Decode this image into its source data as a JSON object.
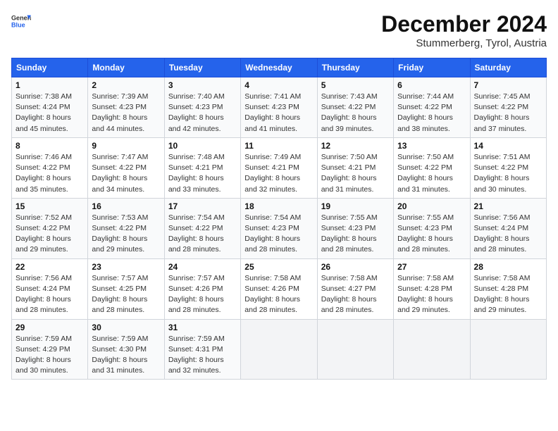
{
  "header": {
    "logo_general": "General",
    "logo_blue": "Blue",
    "month_title": "December 2024",
    "location": "Stummerberg, Tyrol, Austria"
  },
  "weekdays": [
    "Sunday",
    "Monday",
    "Tuesday",
    "Wednesday",
    "Thursday",
    "Friday",
    "Saturday"
  ],
  "weeks": [
    [
      {
        "day": "1",
        "sunrise": "7:38 AM",
        "sunset": "4:24 PM",
        "daylight": "8 hours and 45 minutes."
      },
      {
        "day": "2",
        "sunrise": "7:39 AM",
        "sunset": "4:23 PM",
        "daylight": "8 hours and 44 minutes."
      },
      {
        "day": "3",
        "sunrise": "7:40 AM",
        "sunset": "4:23 PM",
        "daylight": "8 hours and 42 minutes."
      },
      {
        "day": "4",
        "sunrise": "7:41 AM",
        "sunset": "4:23 PM",
        "daylight": "8 hours and 41 minutes."
      },
      {
        "day": "5",
        "sunrise": "7:43 AM",
        "sunset": "4:22 PM",
        "daylight": "8 hours and 39 minutes."
      },
      {
        "day": "6",
        "sunrise": "7:44 AM",
        "sunset": "4:22 PM",
        "daylight": "8 hours and 38 minutes."
      },
      {
        "day": "7",
        "sunrise": "7:45 AM",
        "sunset": "4:22 PM",
        "daylight": "8 hours and 37 minutes."
      }
    ],
    [
      {
        "day": "8",
        "sunrise": "7:46 AM",
        "sunset": "4:22 PM",
        "daylight": "8 hours and 35 minutes."
      },
      {
        "day": "9",
        "sunrise": "7:47 AM",
        "sunset": "4:22 PM",
        "daylight": "8 hours and 34 minutes."
      },
      {
        "day": "10",
        "sunrise": "7:48 AM",
        "sunset": "4:21 PM",
        "daylight": "8 hours and 33 minutes."
      },
      {
        "day": "11",
        "sunrise": "7:49 AM",
        "sunset": "4:21 PM",
        "daylight": "8 hours and 32 minutes."
      },
      {
        "day": "12",
        "sunrise": "7:50 AM",
        "sunset": "4:21 PM",
        "daylight": "8 hours and 31 minutes."
      },
      {
        "day": "13",
        "sunrise": "7:50 AM",
        "sunset": "4:22 PM",
        "daylight": "8 hours and 31 minutes."
      },
      {
        "day": "14",
        "sunrise": "7:51 AM",
        "sunset": "4:22 PM",
        "daylight": "8 hours and 30 minutes."
      }
    ],
    [
      {
        "day": "15",
        "sunrise": "7:52 AM",
        "sunset": "4:22 PM",
        "daylight": "8 hours and 29 minutes."
      },
      {
        "day": "16",
        "sunrise": "7:53 AM",
        "sunset": "4:22 PM",
        "daylight": "8 hours and 29 minutes."
      },
      {
        "day": "17",
        "sunrise": "7:54 AM",
        "sunset": "4:22 PM",
        "daylight": "8 hours and 28 minutes."
      },
      {
        "day": "18",
        "sunrise": "7:54 AM",
        "sunset": "4:23 PM",
        "daylight": "8 hours and 28 minutes."
      },
      {
        "day": "19",
        "sunrise": "7:55 AM",
        "sunset": "4:23 PM",
        "daylight": "8 hours and 28 minutes."
      },
      {
        "day": "20",
        "sunrise": "7:55 AM",
        "sunset": "4:23 PM",
        "daylight": "8 hours and 28 minutes."
      },
      {
        "day": "21",
        "sunrise": "7:56 AM",
        "sunset": "4:24 PM",
        "daylight": "8 hours and 28 minutes."
      }
    ],
    [
      {
        "day": "22",
        "sunrise": "7:56 AM",
        "sunset": "4:24 PM",
        "daylight": "8 hours and 28 minutes."
      },
      {
        "day": "23",
        "sunrise": "7:57 AM",
        "sunset": "4:25 PM",
        "daylight": "8 hours and 28 minutes."
      },
      {
        "day": "24",
        "sunrise": "7:57 AM",
        "sunset": "4:26 PM",
        "daylight": "8 hours and 28 minutes."
      },
      {
        "day": "25",
        "sunrise": "7:58 AM",
        "sunset": "4:26 PM",
        "daylight": "8 hours and 28 minutes."
      },
      {
        "day": "26",
        "sunrise": "7:58 AM",
        "sunset": "4:27 PM",
        "daylight": "8 hours and 28 minutes."
      },
      {
        "day": "27",
        "sunrise": "7:58 AM",
        "sunset": "4:28 PM",
        "daylight": "8 hours and 29 minutes."
      },
      {
        "day": "28",
        "sunrise": "7:58 AM",
        "sunset": "4:28 PM",
        "daylight": "8 hours and 29 minutes."
      }
    ],
    [
      {
        "day": "29",
        "sunrise": "7:59 AM",
        "sunset": "4:29 PM",
        "daylight": "8 hours and 30 minutes."
      },
      {
        "day": "30",
        "sunrise": "7:59 AM",
        "sunset": "4:30 PM",
        "daylight": "8 hours and 31 minutes."
      },
      {
        "day": "31",
        "sunrise": "7:59 AM",
        "sunset": "4:31 PM",
        "daylight": "8 hours and 32 minutes."
      },
      null,
      null,
      null,
      null
    ]
  ],
  "labels": {
    "sunrise": "Sunrise:",
    "sunset": "Sunset:",
    "daylight": "Daylight:"
  }
}
